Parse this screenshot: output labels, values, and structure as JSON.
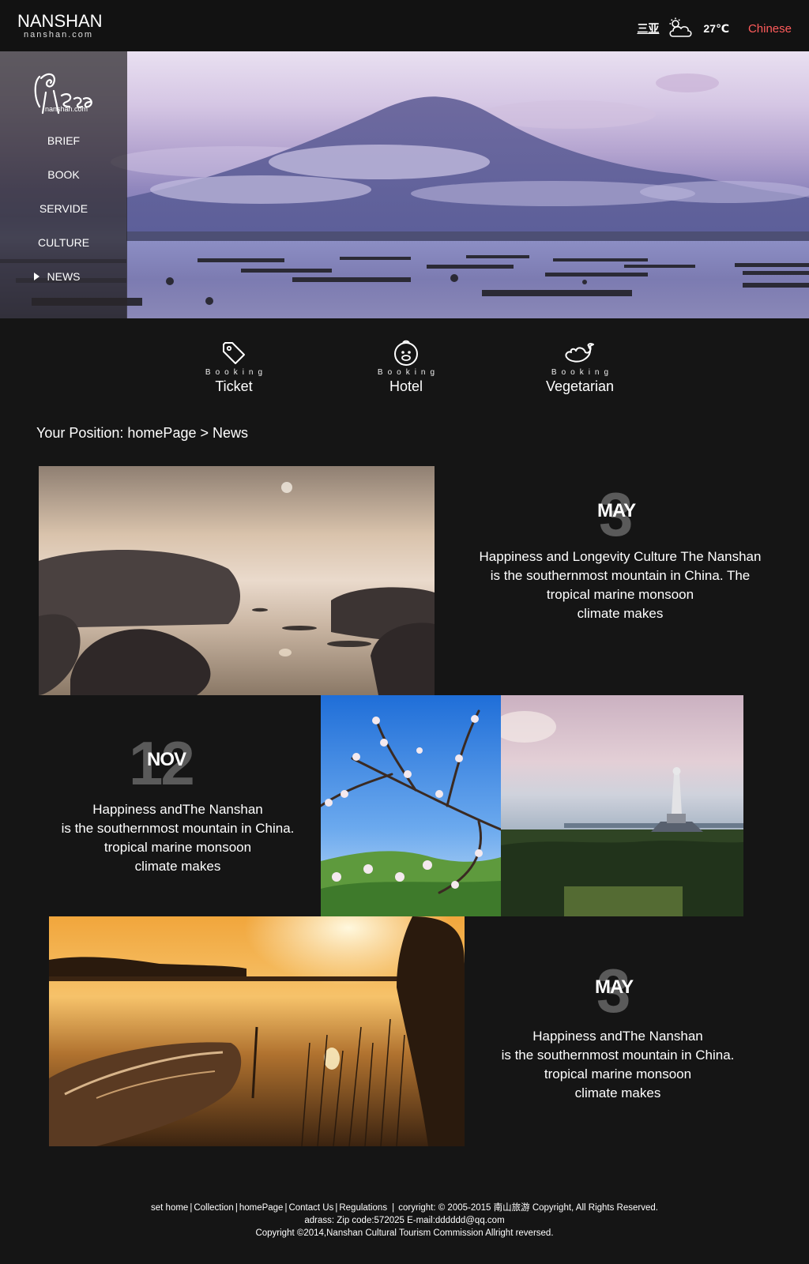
{
  "header": {
    "logo_main": "NANSHAN",
    "logo_sub": "nanshan.com",
    "city": "三亚",
    "weather_icon": "partly-cloudy-icon",
    "temperature": "27℃",
    "language": "Chinese",
    "language_color": "#ff5b5b"
  },
  "side_nav": {
    "logo_text": "nanshan.com",
    "items": [
      {
        "label": "BRIEF"
      },
      {
        "label": "BOOK"
      },
      {
        "label": "SERVIDE"
      },
      {
        "label": "CULTURE"
      },
      {
        "label": "NEWS",
        "active": true
      }
    ]
  },
  "booking": [
    {
      "small": "Booking",
      "label": "Ticket",
      "icon": "tag-icon"
    },
    {
      "small": "Booking",
      "label": "Hotel",
      "icon": "hotel-mascot-icon"
    },
    {
      "small": "Booking",
      "label": "Vegetarian",
      "icon": "bird-icon"
    }
  ],
  "breadcrumb": "Your Position: homePage > News",
  "news": [
    {
      "day": "3",
      "month": "MAY",
      "lines": [
        "Happiness and Longevity Culture The Nanshan",
        "is the southernmost mountain in China. The",
        "tropical marine monsoon",
        "climate makes"
      ]
    },
    {
      "day": "12",
      "month": "NOV",
      "lines": [
        "Happiness andThe Nanshan",
        "is the southernmost mountain in China.",
        "tropical marine monsoon",
        "climate makes"
      ]
    },
    {
      "day": "3",
      "month": "MAY",
      "lines": [
        "Happiness andThe Nanshan",
        "is the southernmost mountain in China.",
        "tropical marine monsoon",
        "climate makes"
      ]
    }
  ],
  "footer": {
    "links": [
      "set home",
      "Collection",
      "homePage",
      "Contact Us",
      "Regulations"
    ],
    "copyright_line": "coryright: © 2005-2015 南山旅游 Copyright, All Rights Reserved.",
    "address_line": "adrass: Zip code:572025 E-mail:dddddd@qq.com",
    "bottom_line": "Copyright ©2014,Nanshan Cultural Tourism Commission Allright reversed."
  }
}
